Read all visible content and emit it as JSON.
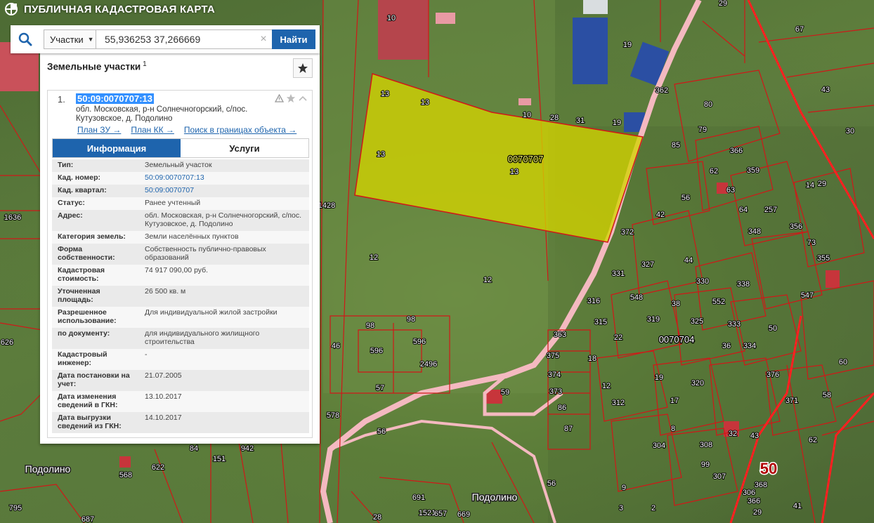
{
  "header": {
    "title": "ПУБЛИЧНАЯ КАДАСТРОВАЯ КАРТА"
  },
  "search": {
    "type_value": "Участки",
    "query": "55,936253 37,266669",
    "find_label": "Найти",
    "clear_symbol": "×"
  },
  "panel": {
    "title": "Земельные участки",
    "count": "1"
  },
  "result": {
    "index": "1.",
    "cad_number": "50:09:0070707:13",
    "address": "обл. Московская, р-н Солнечногорский, с/пос. Кутузовское, д. Подолино",
    "links": [
      "План ЗУ →",
      "План КК →",
      "Поиск в границах объекта →"
    ],
    "tabs": [
      "Информация",
      "Услуги"
    ]
  },
  "attributes": [
    {
      "key": "Тип:",
      "value": "Земельный участок"
    },
    {
      "key": "Кад. номер:",
      "value": "50:09:0070707:13",
      "link": true
    },
    {
      "key": "Кад. квартал:",
      "value": "50:09:0070707",
      "link": true
    },
    {
      "key": "Статус:",
      "value": "Ранее учтенный"
    },
    {
      "key": "Адрес:",
      "value": "обл. Московская, р-н Солнечногорский, с/пос. Кутузовское, д. Подолино"
    },
    {
      "key": "Категория земель:",
      "value": "Земли населённых пунктов"
    },
    {
      "key": "Форма собственности:",
      "value": "Собственность публично-правовых образований"
    },
    {
      "key": "Кадастровая стоимость:",
      "value": "74 917 090,00 руб."
    },
    {
      "key": "Уточненная площадь:",
      "value": "26 500 кв. м"
    },
    {
      "key": "Разрешенное использование:",
      "value": "Для индивидуальной жилой застройки"
    },
    {
      "key": "по документу:",
      "value": "для индивидуального жилищного строительства"
    },
    {
      "key": "Кадастровый инженер:",
      "value": "-"
    },
    {
      "key": "Дата постановки на учет:",
      "value": "21.07.2005"
    },
    {
      "key": "Дата изменения сведений в ГКН:",
      "value": "13.10.2017"
    },
    {
      "key": "Дата выгрузки сведений из ГКН:",
      "value": "14.10.2017"
    }
  ],
  "map": {
    "highlight_color": "#d4d400",
    "boundary_color": "#d01818",
    "quarter_labels": [
      "0070707",
      "0070704"
    ],
    "big_label": "50",
    "place_names": [
      "Подолино",
      "Подолино"
    ],
    "parcel_labels": [
      "10",
      "10",
      "28",
      "31",
      "19",
      "19",
      "13",
      "13",
      "13",
      "13",
      "1428",
      "12",
      "12",
      "362",
      "80",
      "79",
      "85",
      "366",
      "359",
      "62",
      "63",
      "56",
      "42",
      "64",
      "257",
      "348",
      "356",
      "73",
      "355",
      "372",
      "327",
      "44",
      "330",
      "338",
      "331",
      "548",
      "316",
      "38",
      "552",
      "333",
      "547",
      "319",
      "325",
      "315",
      "22",
      "36",
      "334",
      "50",
      "363",
      "375",
      "374",
      "373",
      "86",
      "87",
      "59",
      "98",
      "98",
      "596",
      "596",
      "46",
      "2496",
      "57",
      "578",
      "56",
      "84",
      "1636",
      "626",
      "622",
      "151",
      "942",
      "568",
      "795",
      "687",
      "29",
      "67",
      "43",
      "30",
      "14",
      "29",
      "60",
      "376",
      "371",
      "58",
      "320",
      "312",
      "304",
      "308",
      "307",
      "32",
      "62",
      "41",
      "366",
      "368",
      "306",
      "9",
      "3",
      "2",
      "28",
      "691",
      "669",
      "1521",
      "657",
      "56",
      "8",
      "12",
      "19",
      "17",
      "18",
      "43",
      "99",
      "29",
      "24",
      "21"
    ]
  }
}
